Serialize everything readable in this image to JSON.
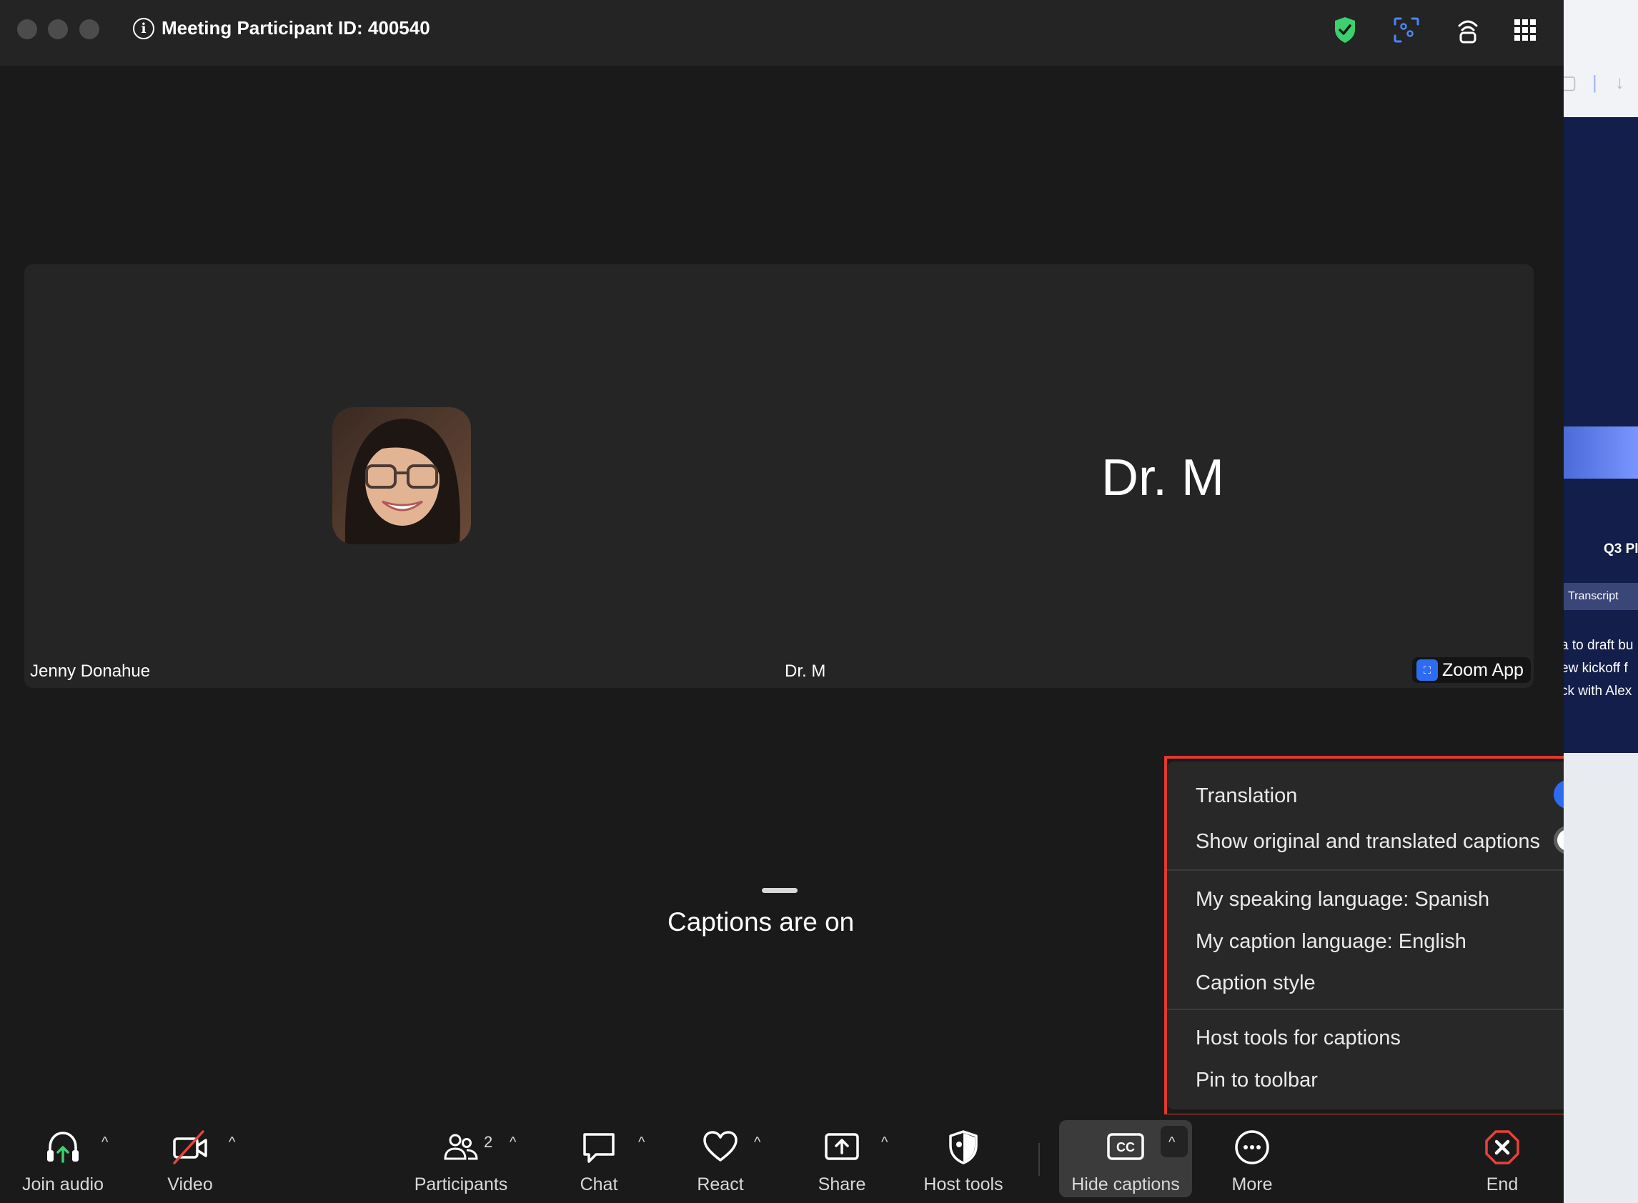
{
  "window": {
    "title": "Meeting Participant ID: 400540",
    "info_icon": "i"
  },
  "stage": {
    "tiles": [
      {
        "name": "Jenny Donahue"
      },
      {
        "name": "Dr. M",
        "display_name": "Dr. M"
      }
    ],
    "zoom_app_badge": "Zoom App"
  },
  "captions": {
    "status": "Captions are on"
  },
  "caption_menu": {
    "translation_label": "Translation",
    "translation_on": true,
    "show_both_label": "Show original and translated captions",
    "show_both_on": false,
    "speaking_language": "My speaking language: Spanish",
    "caption_language": "My caption language: English",
    "caption_style": "Caption style",
    "host_tools": "Host tools for captions",
    "pin": "Pin to toolbar",
    "chevron": "›"
  },
  "toolbar": {
    "join_audio": "Join audio",
    "video": "Video",
    "participants": "Participants",
    "participants_count": "2",
    "chat": "Chat",
    "react": "React",
    "share": "Share",
    "host_tools": "Host tools",
    "hide_captions": "Hide captions",
    "cc": "CC",
    "more": "More",
    "end": "End",
    "caret": "^"
  },
  "side_window": {
    "title": "Q3 Pl",
    "tab": "Transcript",
    "lines": [
      "a to draft bu",
      "ew kickoff f",
      "ck with Alex"
    ]
  },
  "colors": {
    "accent": "#2d6cf0",
    "shield": "#3ecf6e",
    "end": "#e8423a",
    "highlight_border": "#e03a2e"
  }
}
